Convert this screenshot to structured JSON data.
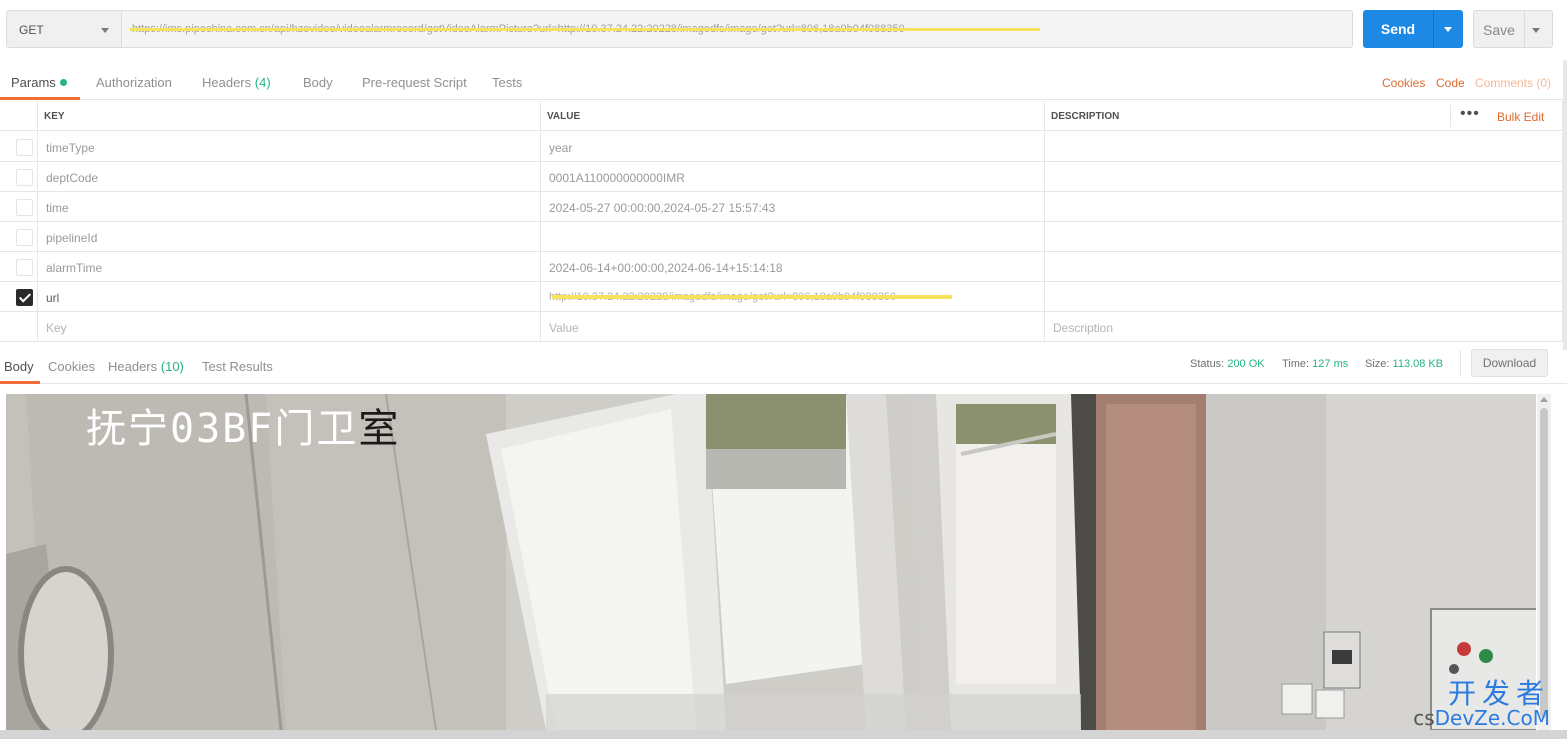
{
  "request": {
    "method": "GET",
    "url": "https://ims.pipechina.com.cn/api/hzevideo/videoalarmrecord/getVideoAlarmPicture?url=http://10.37.24.22:20228/imagedfs/image/get?url=806,18a9b94f088350",
    "send_label": "Send",
    "save_label": "Save"
  },
  "request_tabs": [
    {
      "label": "Params",
      "count": ""
    },
    {
      "label": "Authorization",
      "count": ""
    },
    {
      "label": "Headers",
      "count": "(4)"
    },
    {
      "label": "Body",
      "count": ""
    },
    {
      "label": "Pre-request Script",
      "count": ""
    },
    {
      "label": "Tests",
      "count": ""
    }
  ],
  "right_links": {
    "cookies": "Cookies",
    "code": "Code",
    "comments": "Comments (0)"
  },
  "params": {
    "headers": {
      "key": "KEY",
      "value": "VALUE",
      "description": "DESCRIPTION"
    },
    "more": "•••",
    "bulk_edit": "Bulk Edit",
    "rows": [
      {
        "key": "timeType",
        "value": "year",
        "checked": false
      },
      {
        "key": "deptCode",
        "value": "0001A110000000000IMR",
        "checked": false
      },
      {
        "key": "time",
        "value": "2024-05-27 00:00:00,2024-05-27 15:57:43",
        "checked": false
      },
      {
        "key": "pipelineId",
        "value": "",
        "checked": false
      },
      {
        "key": "alarmTime",
        "value": "2024-06-14+00:00:00,2024-06-14+15:14:18",
        "checked": false
      },
      {
        "key": "url",
        "value": "http://10.37.24.22:20228/imagedfs/image/get?url=806,18a9b94f088350",
        "checked": true
      }
    ],
    "placeholders": {
      "key": "Key",
      "value": "Value",
      "description": "Description"
    }
  },
  "response_tabs": [
    {
      "label": "Body",
      "count": ""
    },
    {
      "label": "Cookies",
      "count": ""
    },
    {
      "label": "Headers",
      "count": "(10)"
    },
    {
      "label": "Test Results",
      "count": ""
    }
  ],
  "status": {
    "status_label": "Status:",
    "status_value": "200 OK",
    "time_label": "Time:",
    "time_value": "127 ms",
    "size_label": "Size:",
    "size_value": "113.08 KB",
    "download": "Download"
  },
  "image": {
    "caption_light": "抚宁03BF门卫",
    "caption_dark": "室"
  },
  "watermark": {
    "line1": "开发者",
    "prefix": "cs",
    "line2": "DevZe.CoM"
  },
  "colors": {
    "accent": "#f26b3a",
    "send": "#1e88e5",
    "status_ok": "#26b47f"
  }
}
